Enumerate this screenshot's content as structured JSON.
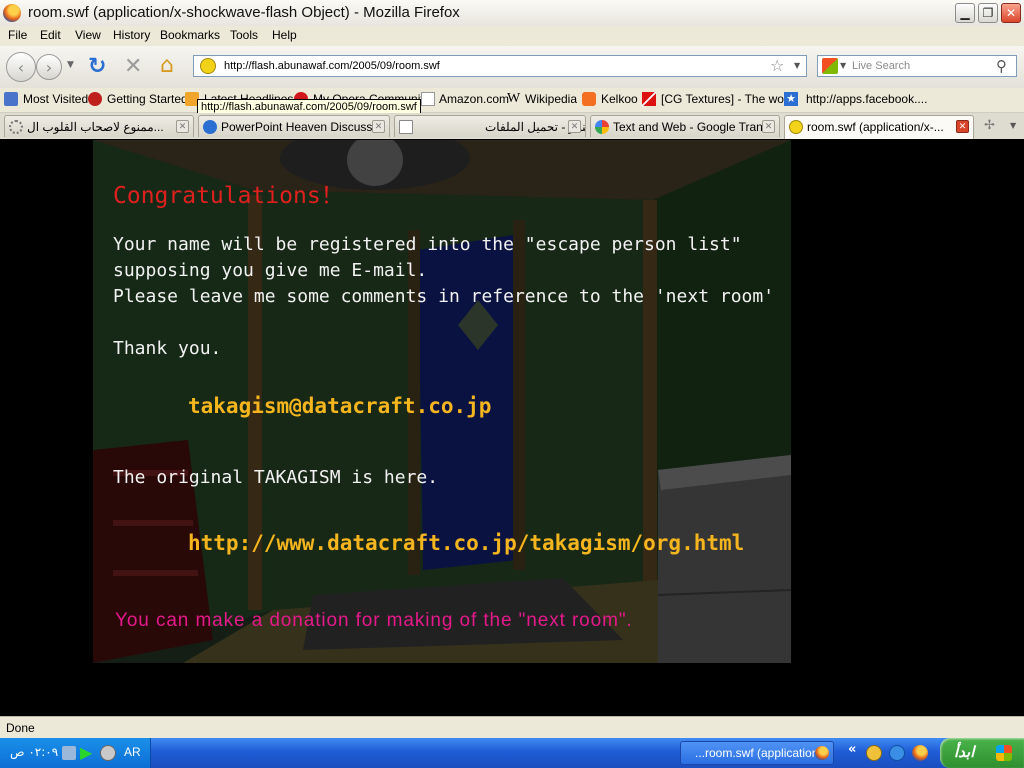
{
  "window": {
    "title": "room.swf (application/x-shockwave-flash Object) - Mozilla Firefox"
  },
  "menu": [
    "File",
    "Edit",
    "View",
    "History",
    "Bookmarks",
    "Tools",
    "Help"
  ],
  "nav": {
    "url": "http://flash.abunawaf.com/2005/09/room.swf",
    "search_placeholder": "Live Search"
  },
  "bookmarks": [
    "Most Visited",
    "Getting Started",
    "Latest Headlines",
    "My Opera Community",
    "Amazon.com",
    "Wikipedia",
    "Kelkoo",
    "[CG Textures] - The wo...",
    "http://apps.facebook...."
  ],
  "tooltip": "http://flash.abunawaf.com/2005/09/room.swf",
  "tabs": [
    {
      "label": "ممنوع لاصحاب القلوب ال...",
      "active": false
    },
    {
      "label": "PowerPoint Heaven Discuss...",
      "active": false
    },
    {
      "label": "المنابر - تحميل الملفات",
      "active": false
    },
    {
      "label": "Text and Web - Google Tran...",
      "active": false
    },
    {
      "label": "room.swf (application/x-...",
      "active": true
    }
  ],
  "flash": {
    "heading": "Congratulations！",
    "line1": "Your name will be registered into the \"escape person list\"",
    "line2": "supposing you give me E-mail.",
    "line3": "Please leave me some comments in reference to the 'next room'",
    "thanks": "Thank you.",
    "email": "takagism@datacraft.co.jp",
    "original": "The original TAKAGISM is here.",
    "link": "http://www.datacraft.co.jp/takagism/org.html",
    "donate": "You can make a donation for making of the \"next room\"."
  },
  "status": {
    "text": "Done"
  },
  "taskbar": {
    "window_item": "...room.swf (application",
    "start": "ابدأ",
    "clock": "٠٢:٠٩ ص",
    "lang": "AR"
  }
}
